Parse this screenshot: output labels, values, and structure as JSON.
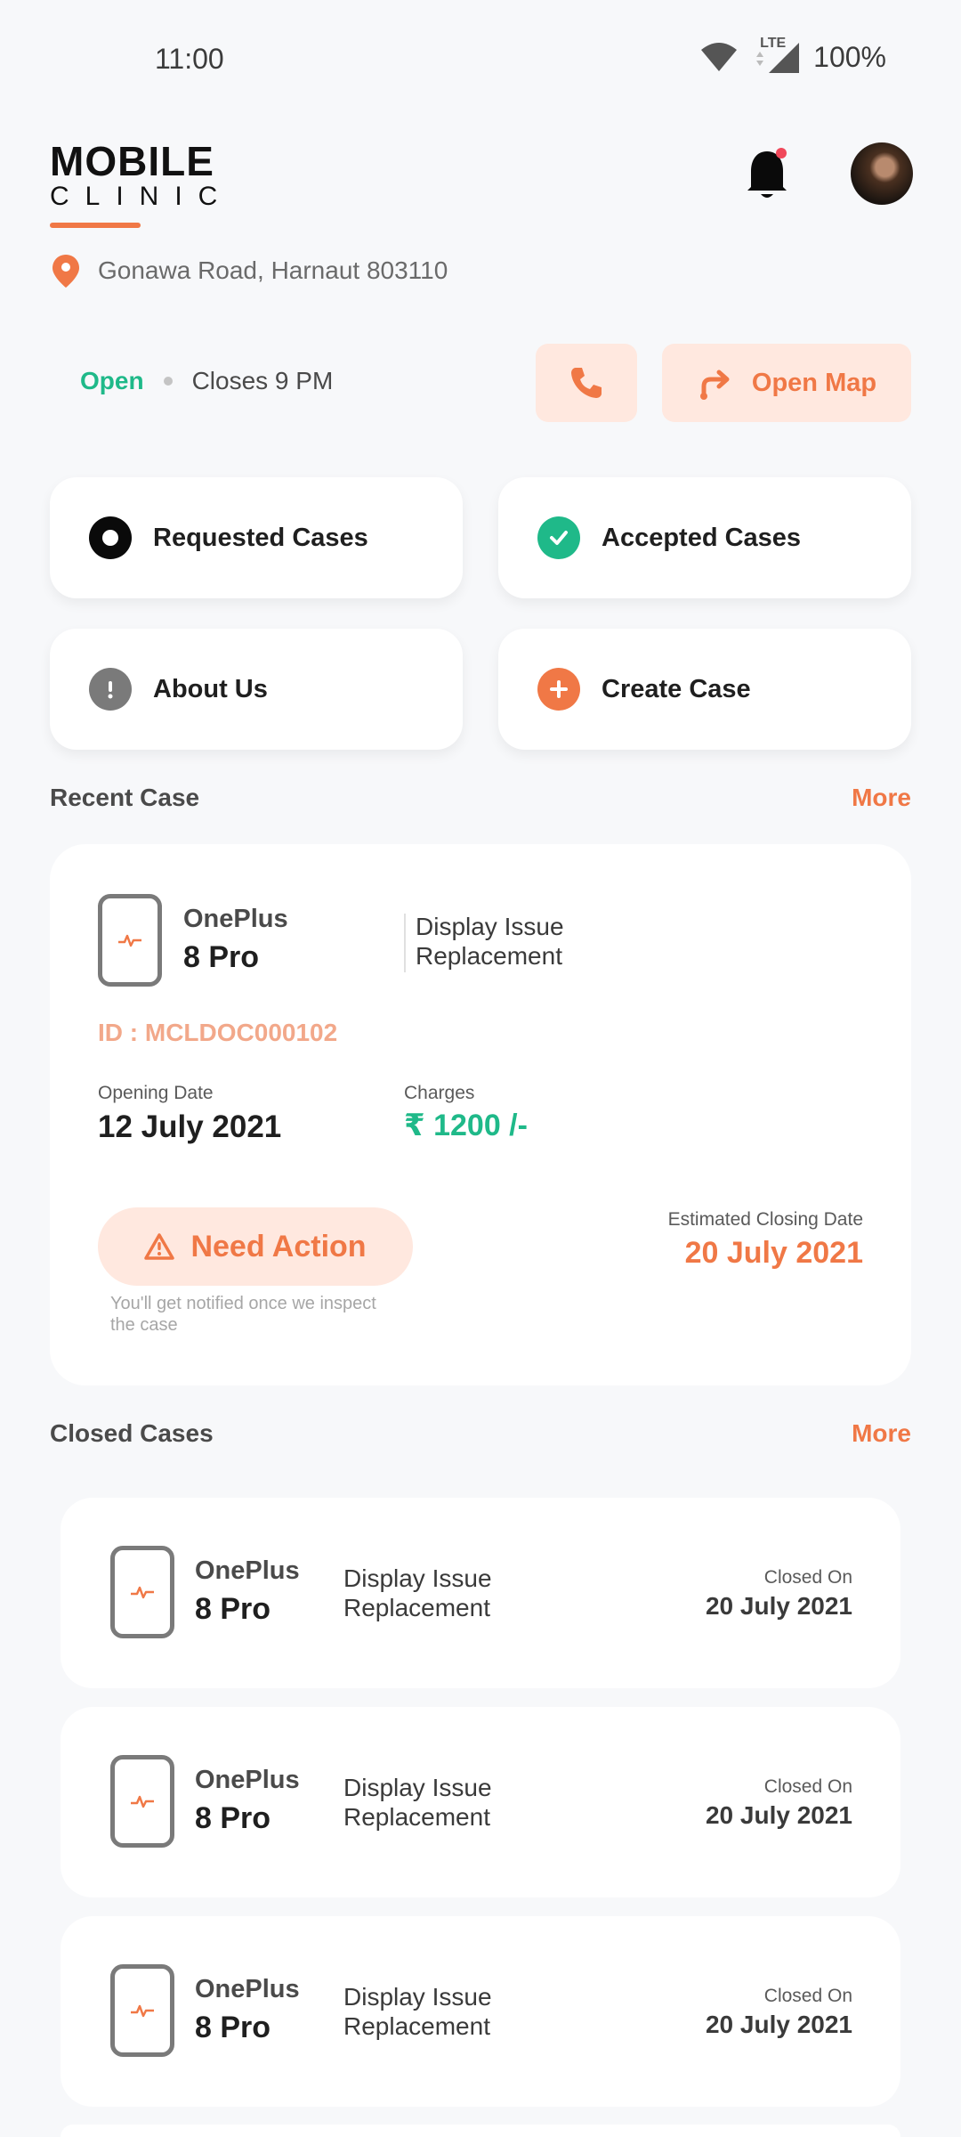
{
  "status_bar": {
    "time": "11:00",
    "network": "LTE",
    "battery": "100%"
  },
  "header": {
    "logo_top": "MOBILE",
    "logo_bottom": "CLINIC",
    "address": "Gonawa Road, Harnaut 803110"
  },
  "store": {
    "open_status": "Open",
    "closes": "Closes 9 PM",
    "open_map_label": "Open Map"
  },
  "tiles": [
    {
      "label": "Requested Cases"
    },
    {
      "label": "Accepted Cases"
    },
    {
      "label": "About Us"
    },
    {
      "label": "Create Case"
    }
  ],
  "recent": {
    "section_title": "Recent Case",
    "more_label": "More",
    "brand": "OnePlus",
    "model": "8 Pro",
    "issue_line1": "Display Issue",
    "issue_line2": "Replacement",
    "case_id": "ID : MCLDOC000102",
    "opening_date_label": "Opening Date",
    "opening_date": "12 July 2021",
    "charges_label": "Charges",
    "charges": "₹ 1200 /-",
    "action_label": "Need Action",
    "notify_text": "You'll get notified once we inspect the case",
    "est_label": "Estimated Closing Date",
    "est_date": "20 July 2021"
  },
  "closed": {
    "section_title": "Closed Cases",
    "more_label": "More",
    "items": [
      {
        "brand": "OnePlus",
        "model": "8 Pro",
        "issue_line1": "Display Issue",
        "issue_line2": "Replacement",
        "closed_label": "Closed On",
        "closed_date": "20 July 2021"
      },
      {
        "brand": "OnePlus",
        "model": "8 Pro",
        "issue_line1": "Display Issue",
        "issue_line2": "Replacement",
        "closed_label": "Closed On",
        "closed_date": "20 July 2021"
      },
      {
        "brand": "OnePlus",
        "model": "8 Pro",
        "issue_line1": "Display Issue",
        "issue_line2": "Replacement",
        "closed_label": "Closed On",
        "closed_date": "20 July 2021"
      }
    ]
  },
  "colors": {
    "accent": "#F07846",
    "accent_light": "#FFE8DF",
    "success": "#1FB989",
    "background": "#F7F8FA"
  }
}
